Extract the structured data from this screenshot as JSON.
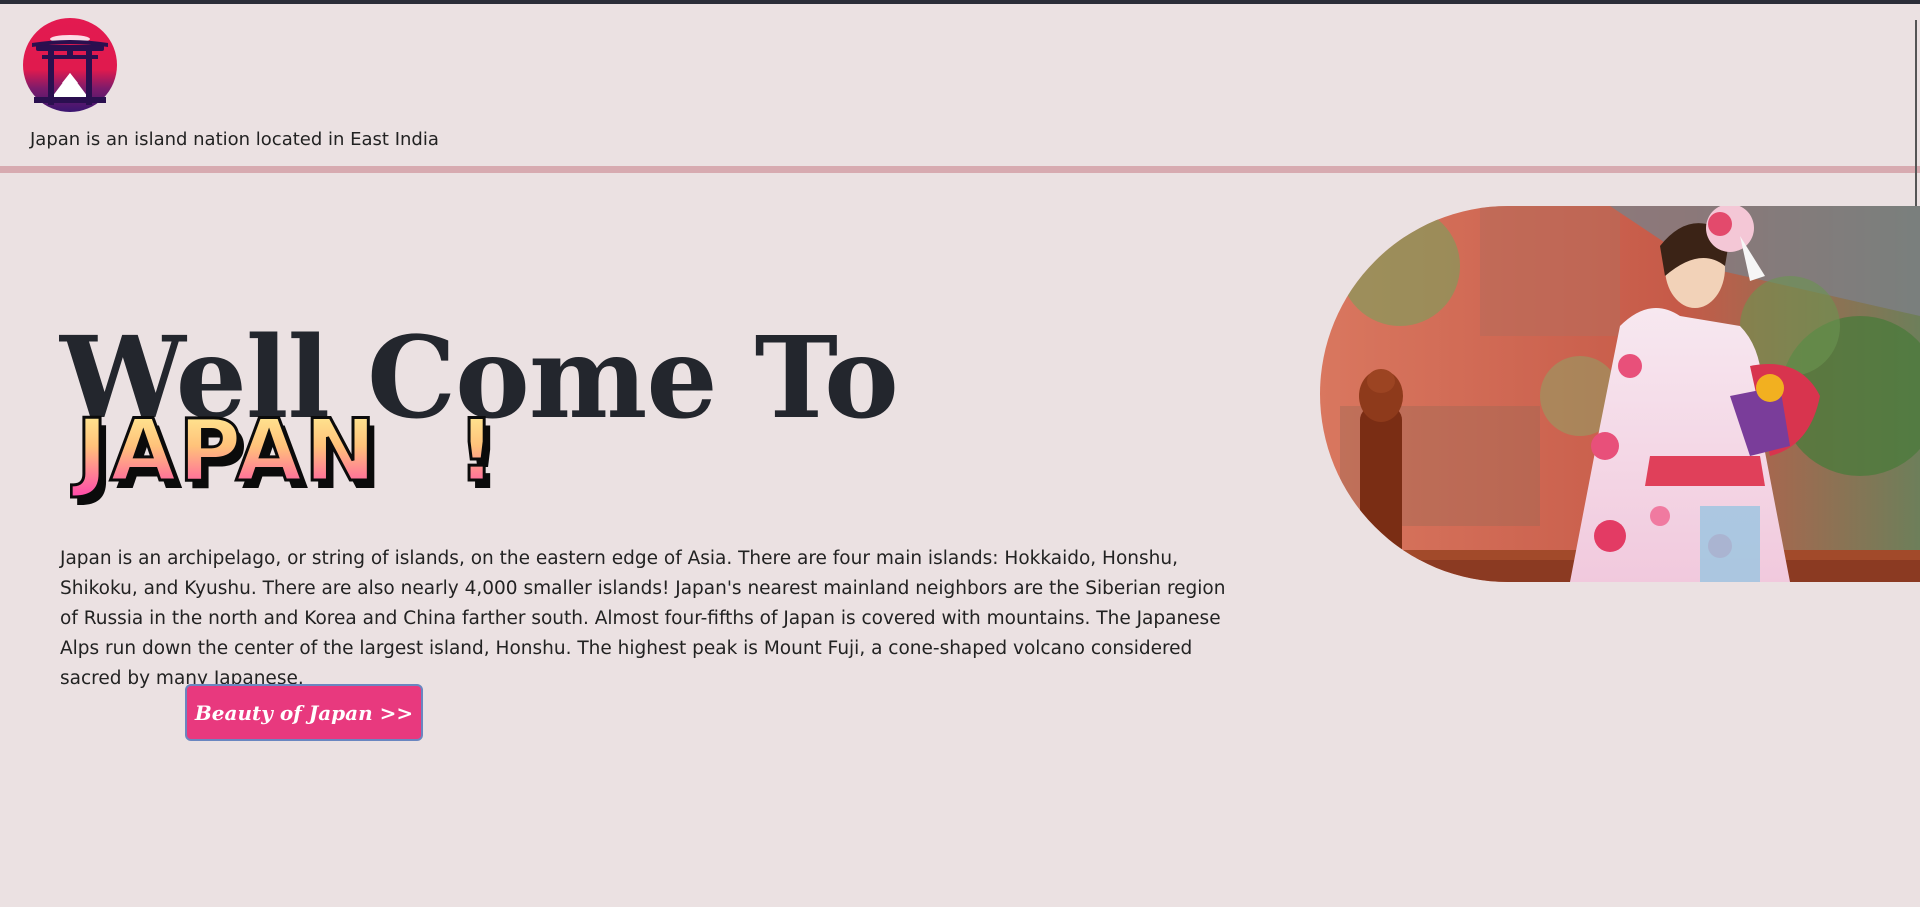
{
  "header": {
    "tagline": "Japan is an island nation located in East India"
  },
  "main": {
    "heading": "Well Come To",
    "highlight_word": "JAPAN",
    "highlight_punct": "!",
    "description": "Japan is an archipelago, or string of islands, on the eastern edge of Asia. There are four main islands: Hokkaido, Honshu, Shikoku, and Kyushu. There are also nearly 4,000 smaller islands! Japan's nearest mainland neighbors are the Siberian region of Russia in the north and Korea and China farther south. Almost four-fifths of Japan is covered with mountains. The Japanese Alps run down the center of the largest island, Honshu. The highest peak is Mount Fuji, a cone-shaped volcano considered sacred by many Japanese.",
    "cta_label": "Beauty of Japan >>"
  },
  "colors": {
    "page_bg": "#ebe1e2",
    "accent": "#e8397e",
    "header_divider": "#d7aab0",
    "logo_red": "#e0194f",
    "logo_purple": "#3a1570"
  },
  "icons": {
    "logo": "torii-gate-logo",
    "hero": "kimono-woman-photo"
  }
}
